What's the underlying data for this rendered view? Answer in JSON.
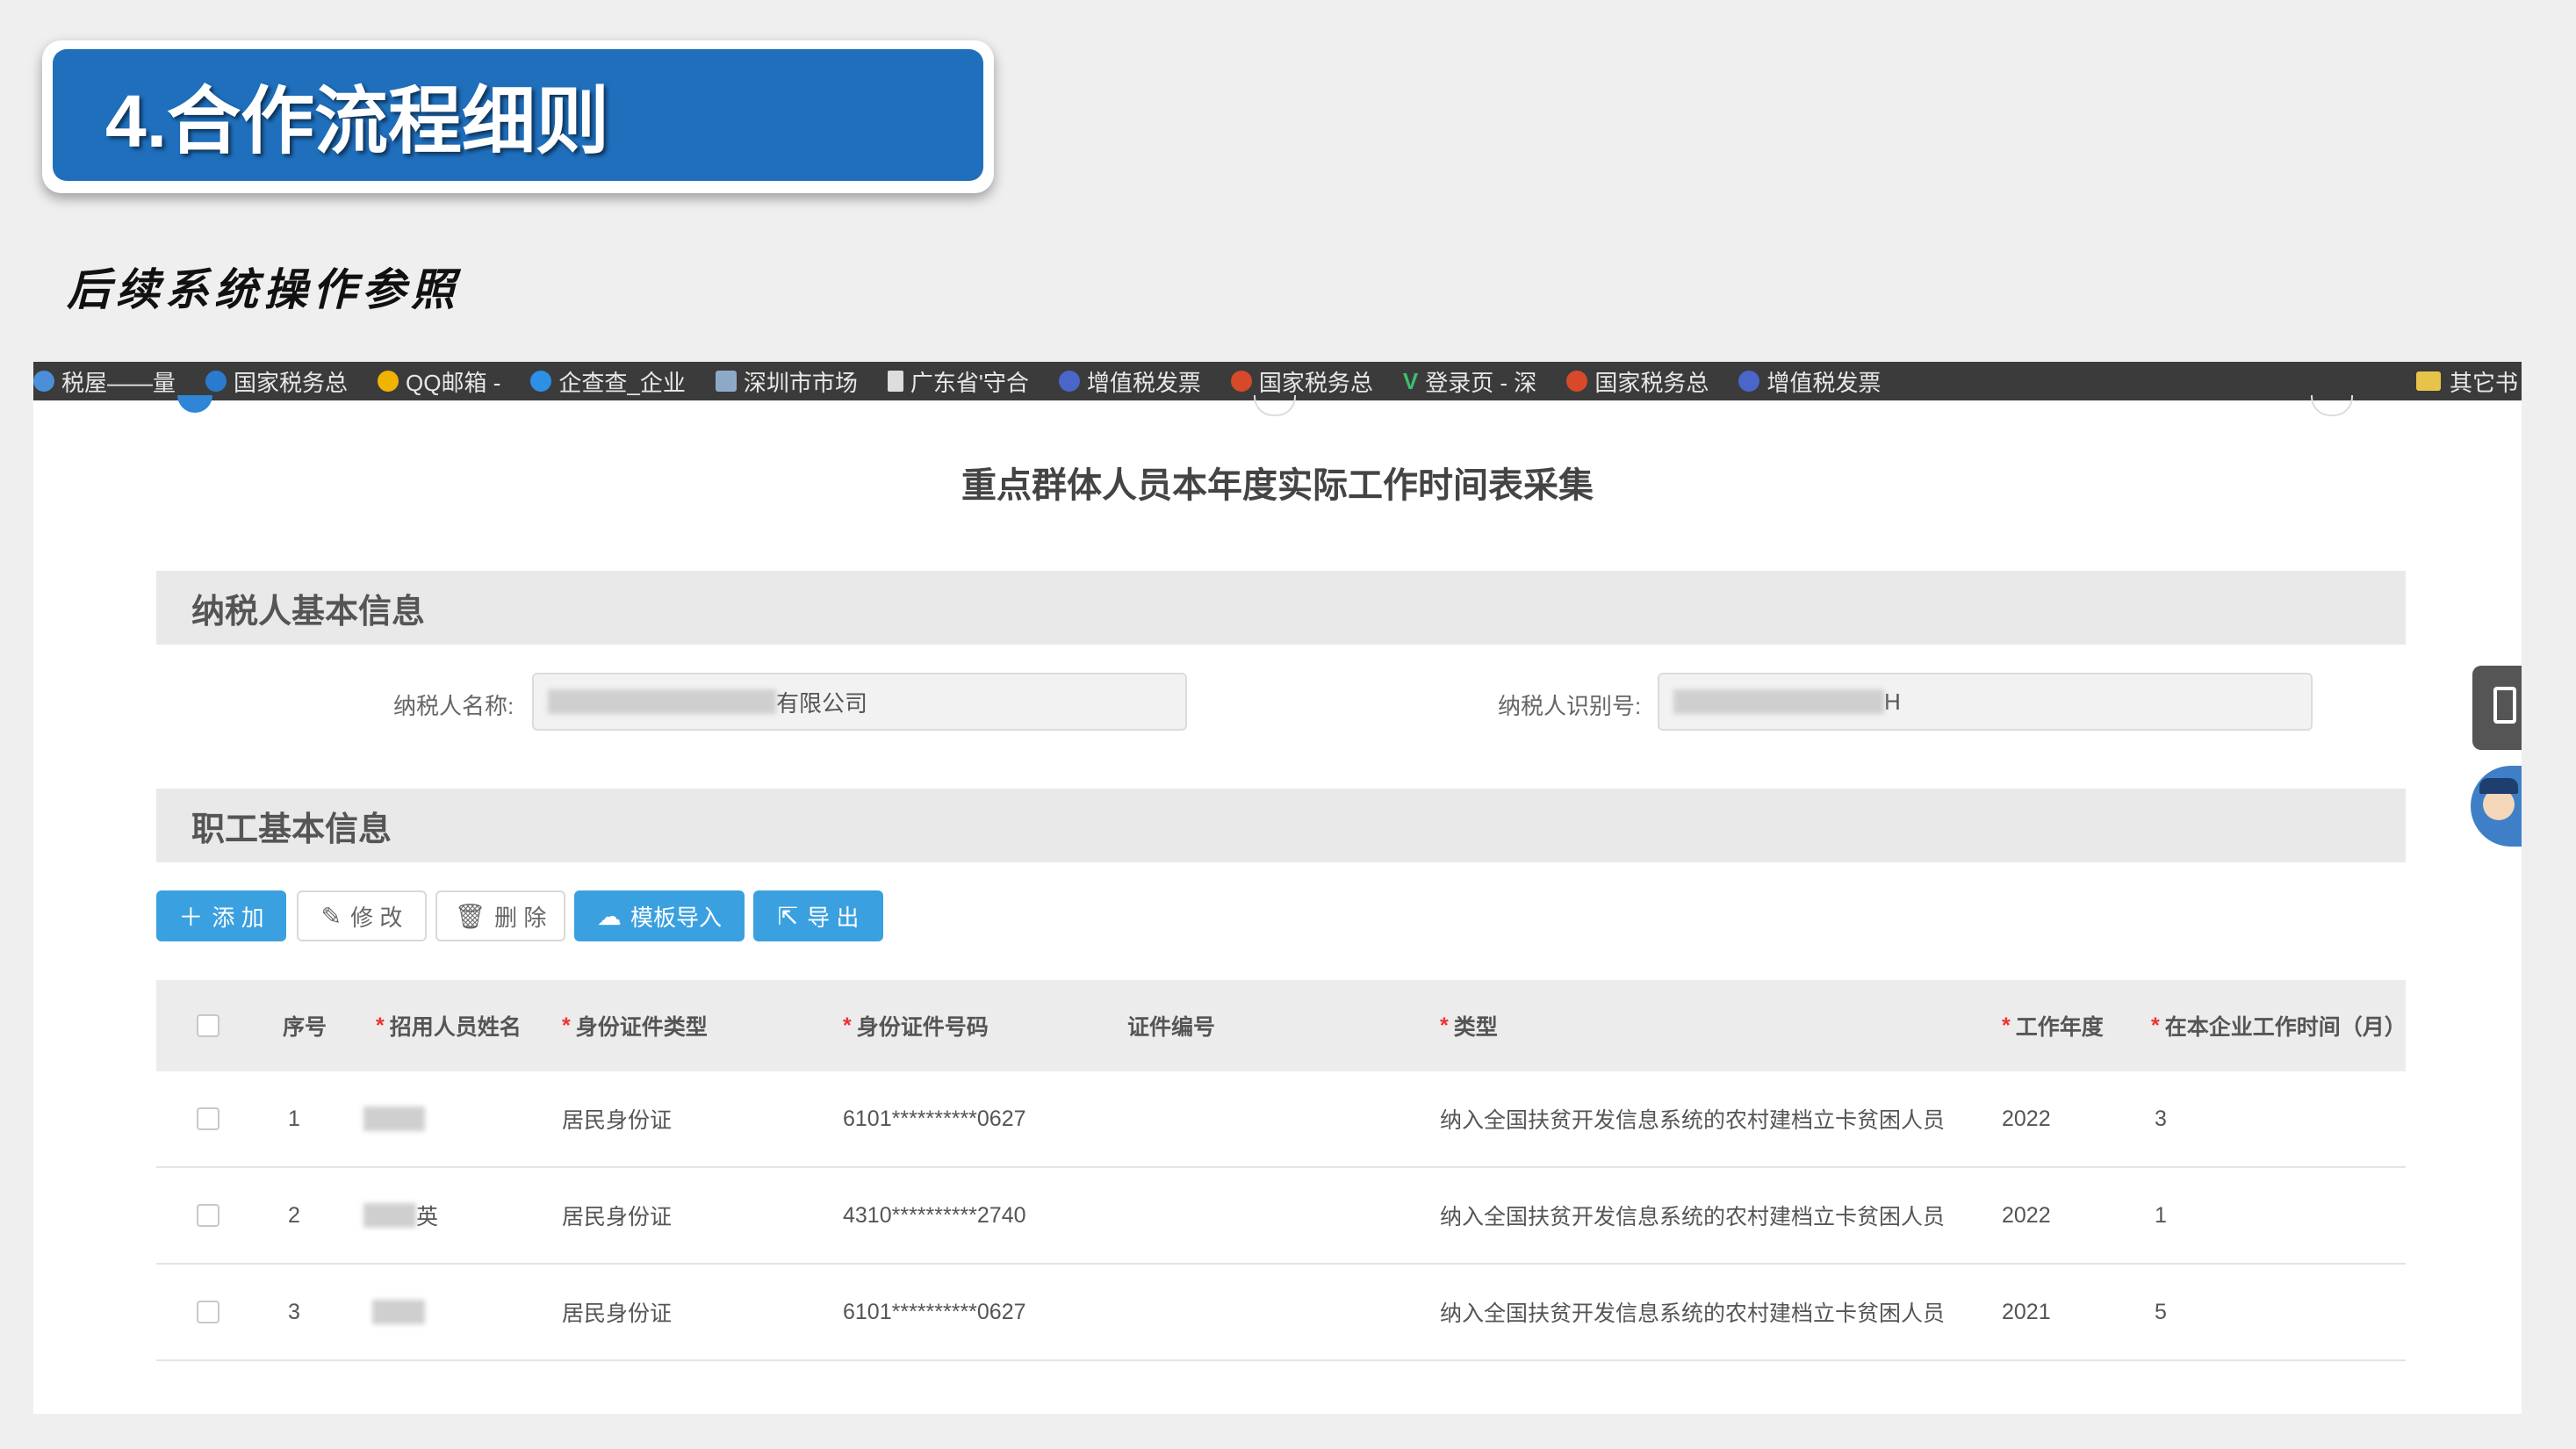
{
  "slide": {
    "title": "4.合作流程细则",
    "subtitle": "后续系统操作参照"
  },
  "browser": {
    "bookmarks": [
      {
        "label": "税屋——量",
        "icon_color": "#4a8fd8"
      },
      {
        "label": "国家税务总",
        "icon_color": "#2a7ad0"
      },
      {
        "label": "QQ邮箱 -",
        "icon_color": "#f0b400"
      },
      {
        "label": "企查查_企业",
        "icon_color": "#2d8fe6"
      },
      {
        "label": "深圳市市场",
        "icon_color": "#8ea9c8"
      },
      {
        "label": "广东省'守合",
        "icon_color": "#dddddd"
      },
      {
        "label": "增值税发票",
        "icon_color": "#4a66c8"
      },
      {
        "label": "国家税务总",
        "icon_color": "#d64a2a"
      },
      {
        "label": "登录页 - 深",
        "icon_color": "#3cbf70"
      },
      {
        "label": "国家税务总",
        "icon_color": "#d64a2a"
      },
      {
        "label": "增值税发票",
        "icon_color": "#4a66c8"
      }
    ],
    "other_bookmarks": "其它书"
  },
  "form": {
    "heading": "重点群体人员本年度实际工作时间表采集",
    "taxpayer_section": "纳税人基本信息",
    "taxpayer_name_label": "纳税人名称:",
    "taxpayer_name_value": "有限公司",
    "taxpayer_id_label": "纳税人识别号:",
    "taxpayer_id_value": "H",
    "employee_section": "职工基本信息"
  },
  "toolbar": {
    "add": "添 加",
    "edit": "修 改",
    "delete": "删 除",
    "template_import": "模板导入",
    "export": "导 出"
  },
  "table": {
    "headers": {
      "seq": "序号",
      "name": "招用人员姓名",
      "id_type": "身份证件类型",
      "id_number": "身份证件号码",
      "cert_number": "证件编号",
      "category": "类型",
      "work_year": "工作年度",
      "months": "在本企业工作时间（月）"
    },
    "rows": [
      {
        "seq": "1",
        "name": "",
        "id_type": "居民身份证",
        "id_number": "6101**********0627",
        "cert_number": "",
        "category": "纳入全国扶贫开发信息系统的农村建档立卡贫困人员",
        "work_year": "2022",
        "months": "3"
      },
      {
        "seq": "2",
        "name": "英",
        "id_type": "居民身份证",
        "id_number": "4310**********2740",
        "cert_number": "",
        "category": "纳入全国扶贫开发信息系统的农村建档立卡贫困人员",
        "work_year": "2022",
        "months": "1"
      },
      {
        "seq": "3",
        "name": "",
        "id_type": "居民身份证",
        "id_number": "6101**********0627",
        "cert_number": "",
        "category": "纳入全国扶贫开发信息系统的农村建档立卡贫困人员",
        "work_year": "2021",
        "months": "5"
      }
    ]
  },
  "colors": {
    "banner": "#1f6fbd",
    "primary_button": "#3aa0df",
    "required_mark": "#e33333"
  }
}
